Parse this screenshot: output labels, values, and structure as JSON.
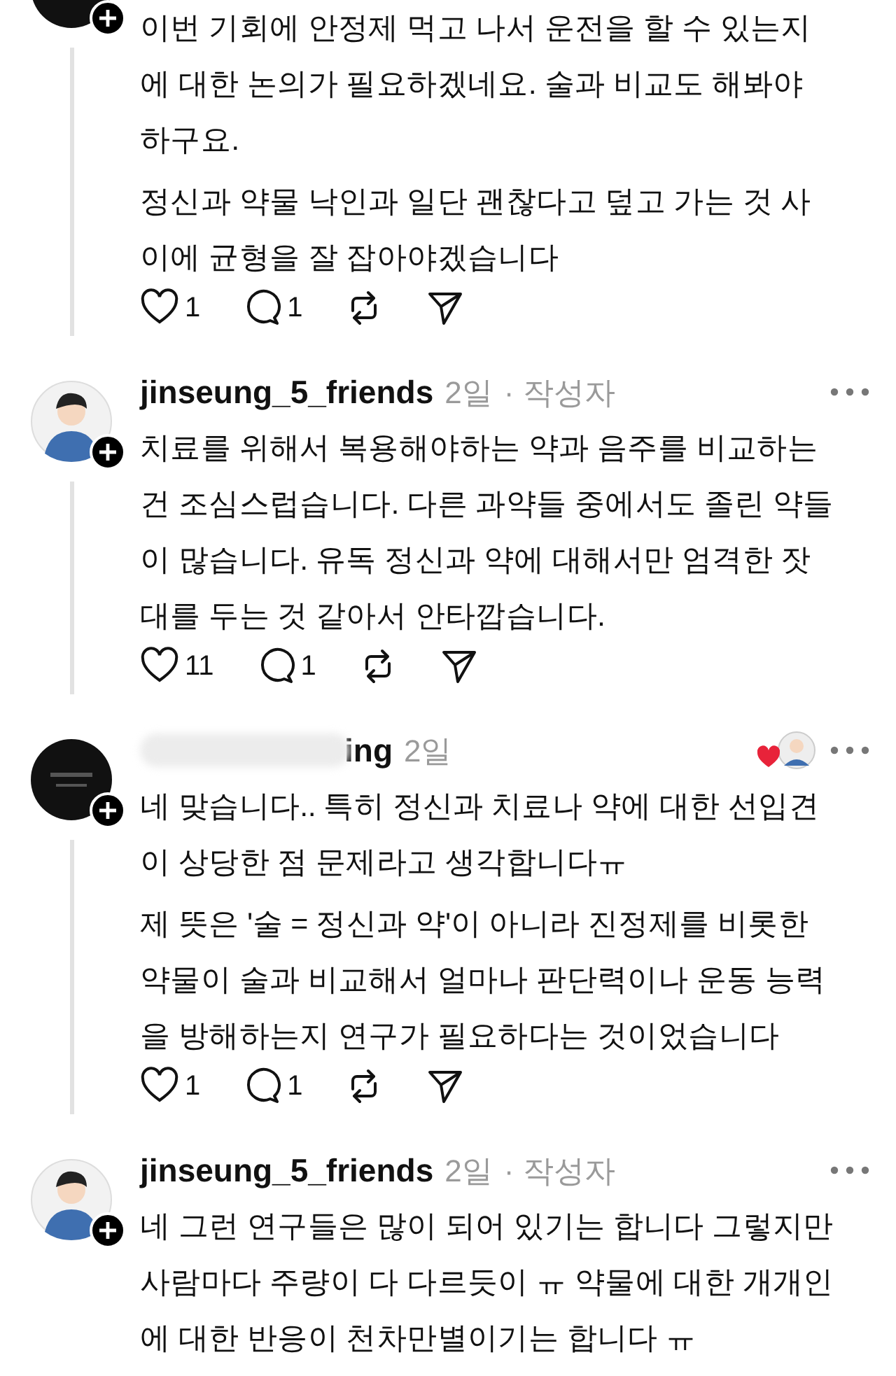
{
  "comments": [
    {
      "avatar": {
        "kind": "logo"
      },
      "paragraphs": [
        [
          "이번 기회에 안정제 먹고 나서 운전을 할 수 있는지",
          "에 대한 논의가 필요하겠네요. 술과 비교도 해봐야",
          "하구요."
        ],
        [
          "정신과 약물 낙인과 일단 괜찮다고 덮고 가는 것 사",
          "이에 균형을 잘 잡아야겠습니다"
        ]
      ],
      "likes": "1",
      "replies": "1"
    },
    {
      "avatar": {
        "kind": "person"
      },
      "username": "jinseung_5_friends",
      "username_blurred": false,
      "time": "2일",
      "author_tag": "· 작성자",
      "liked_by_author": false,
      "paragraphs": [
        [
          "치료를 위해서 복용해야하는 약과 음주를 비교하는",
          "건 조심스럽습니다. 다른 과약들 중에서도 졸린 약들",
          "이 많습니다. 유독 정신과 약에 대해서만 엄격한 잣",
          "대를 두는 것 같아서 안타깝습니다."
        ]
      ],
      "likes": "11",
      "replies": "1"
    },
    {
      "avatar": {
        "kind": "logo"
      },
      "username": "ing",
      "username_blurred": true,
      "time": "2일",
      "liked_by_author": true,
      "paragraphs": [
        [
          "네 맞습니다.. 특히 정신과 치료나 약에 대한 선입견",
          "이 상당한 점 문제라고 생각합니다ㅠ"
        ],
        [
          "제 뜻은 '술 = 정신과 약'이 아니라 진정제를 비롯한",
          "약물이 술과 비교해서 얼마나 판단력이나 운동 능력",
          "을 방해하는지 연구가 필요하다는 것이었습니다"
        ]
      ],
      "likes": "1",
      "replies": "1"
    },
    {
      "avatar": {
        "kind": "person"
      },
      "username": "jinseung_5_friends",
      "username_blurred": false,
      "time": "2일",
      "author_tag": "· 작성자",
      "liked_by_author": false,
      "paragraphs": [
        [
          "네 그런 연구들은 많이 되어 있기는 합니다 그렇지만",
          "사람마다 주량이 다 다르듯이 ㅠ 약물에 대한 개개인",
          "에 대한 반응이 천차만별이기는 합니다 ㅠ"
        ]
      ]
    }
  ]
}
